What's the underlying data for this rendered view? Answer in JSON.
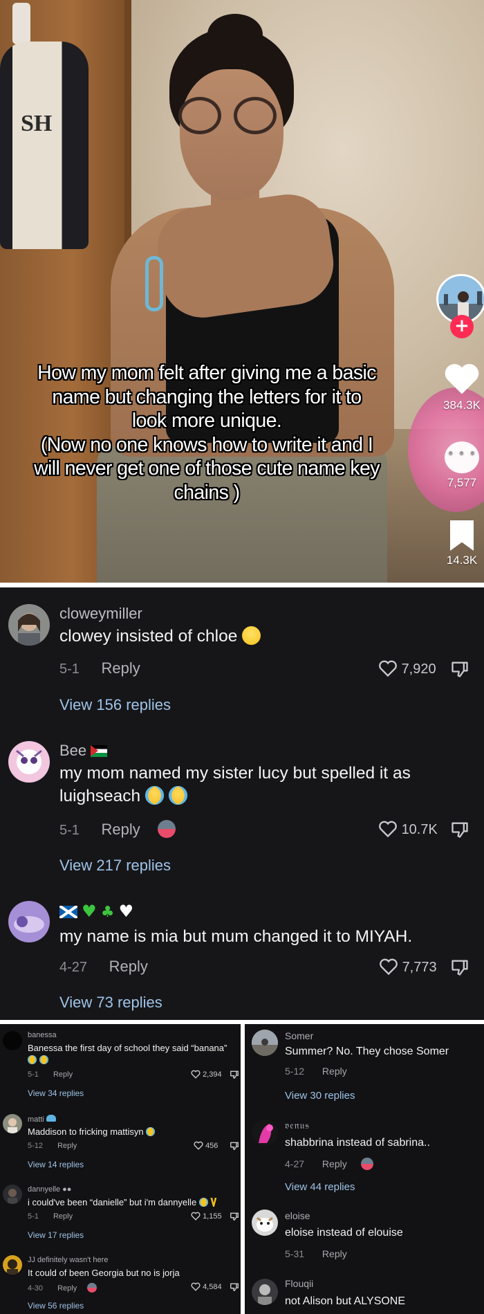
{
  "video": {
    "caption_lines": [
      "How my mom felt after giving me a basic",
      "name  but changing the letters for it to",
      "look more unique.",
      "(Now no one knows how to write it and I",
      "will never get one of those cute name key",
      "chains )"
    ],
    "jacket_letters": "SH",
    "follow_icon": "plus",
    "likes": "384.3K",
    "comments": "7,577",
    "saves": "14.3K"
  },
  "main_comments": [
    {
      "username": "cloweymiller",
      "text": "clowey insisted of chloe",
      "date": "5-1",
      "reply_label": "Reply",
      "likes": "7,920",
      "view_replies": "View 156 replies"
    },
    {
      "username": "Bee",
      "text_line1": "my mom named my sister lucy but spelled it as",
      "text_line2": "luighseach",
      "date": "5-1",
      "reply_label": "Reply",
      "likes": "10.7K",
      "view_replies": "View 217 replies"
    },
    {
      "username": "",
      "text": "my name is mia but mum changed it to MIYAH.",
      "date": "4-27",
      "reply_label": "Reply",
      "likes": "7,773",
      "view_replies": "View 73 replies"
    }
  ],
  "left_panel": [
    {
      "username": "banessa",
      "text": "Banessa the first day of school they said “banana”",
      "date": "5-1",
      "reply_label": "Reply",
      "likes": "2,394",
      "view_replies": "View 34 replies"
    },
    {
      "username": "matti",
      "text": "Maddison to fricking mattisyn",
      "date": "5-12",
      "reply_label": "Reply",
      "likes": "456",
      "view_replies": "View 14 replies"
    },
    {
      "username": "dannyelle",
      "text": "i could've been “danielle” but i'm dannyelle",
      "date": "5-1",
      "reply_label": "Reply",
      "likes": "1,155",
      "view_replies": "View 17 replies"
    },
    {
      "username": "JJ definitely wasn't here",
      "text": "It could of been Georgia but no is jorja",
      "date": "4-30",
      "reply_label": "Reply",
      "likes": "4,584",
      "view_replies": "View 56 replies"
    }
  ],
  "right_panel": [
    {
      "username": "Somer",
      "text": "Summer? No. They chose Somer",
      "date": "5-12",
      "reply_label": "Reply",
      "view_replies": "View 30 replies"
    },
    {
      "username": "𝔳𝔢𝔫𝔲𝔰",
      "text": "shabbrina instead of sabrina..",
      "date": "4-27",
      "reply_label": "Reply",
      "view_replies": "View 44 replies"
    },
    {
      "username": "eloise",
      "text": "eloise instead of elouise",
      "date": "5-31",
      "reply_label": "Reply"
    },
    {
      "username": "Flouqii",
      "text": "not Alison but ALYSONE"
    }
  ],
  "colors": {
    "dark_bg": "#161619",
    "link_blue": "#9fc3e8",
    "tiktok_red": "#fe2c55"
  }
}
